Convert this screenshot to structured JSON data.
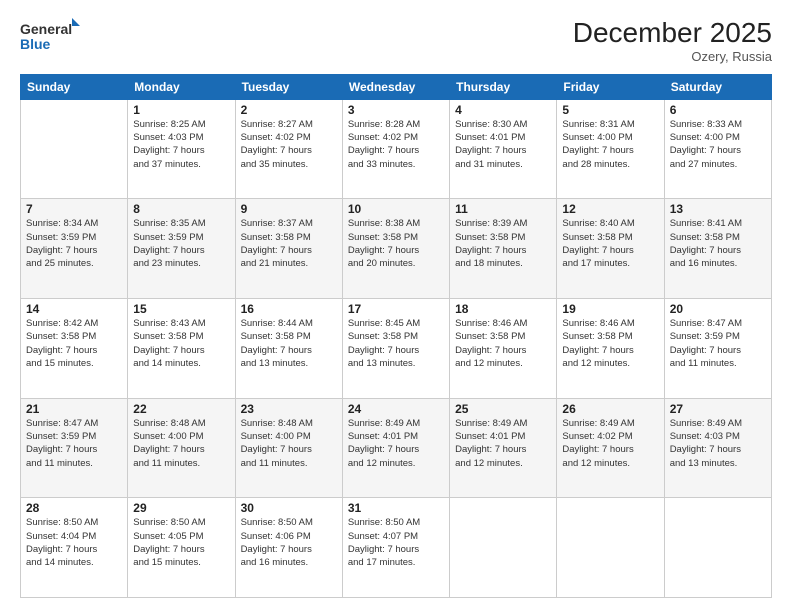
{
  "logo": {
    "line1": "General",
    "line2": "Blue"
  },
  "header": {
    "month": "December 2025",
    "location": "Ozery, Russia"
  },
  "weekdays": [
    "Sunday",
    "Monday",
    "Tuesday",
    "Wednesday",
    "Thursday",
    "Friday",
    "Saturday"
  ],
  "weeks": [
    [
      {
        "day": "",
        "info": ""
      },
      {
        "day": "1",
        "info": "Sunrise: 8:25 AM\nSunset: 4:03 PM\nDaylight: 7 hours\nand 37 minutes."
      },
      {
        "day": "2",
        "info": "Sunrise: 8:27 AM\nSunset: 4:02 PM\nDaylight: 7 hours\nand 35 minutes."
      },
      {
        "day": "3",
        "info": "Sunrise: 8:28 AM\nSunset: 4:02 PM\nDaylight: 7 hours\nand 33 minutes."
      },
      {
        "day": "4",
        "info": "Sunrise: 8:30 AM\nSunset: 4:01 PM\nDaylight: 7 hours\nand 31 minutes."
      },
      {
        "day": "5",
        "info": "Sunrise: 8:31 AM\nSunset: 4:00 PM\nDaylight: 7 hours\nand 28 minutes."
      },
      {
        "day": "6",
        "info": "Sunrise: 8:33 AM\nSunset: 4:00 PM\nDaylight: 7 hours\nand 27 minutes."
      }
    ],
    [
      {
        "day": "7",
        "info": "Sunrise: 8:34 AM\nSunset: 3:59 PM\nDaylight: 7 hours\nand 25 minutes."
      },
      {
        "day": "8",
        "info": "Sunrise: 8:35 AM\nSunset: 3:59 PM\nDaylight: 7 hours\nand 23 minutes."
      },
      {
        "day": "9",
        "info": "Sunrise: 8:37 AM\nSunset: 3:58 PM\nDaylight: 7 hours\nand 21 minutes."
      },
      {
        "day": "10",
        "info": "Sunrise: 8:38 AM\nSunset: 3:58 PM\nDaylight: 7 hours\nand 20 minutes."
      },
      {
        "day": "11",
        "info": "Sunrise: 8:39 AM\nSunset: 3:58 PM\nDaylight: 7 hours\nand 18 minutes."
      },
      {
        "day": "12",
        "info": "Sunrise: 8:40 AM\nSunset: 3:58 PM\nDaylight: 7 hours\nand 17 minutes."
      },
      {
        "day": "13",
        "info": "Sunrise: 8:41 AM\nSunset: 3:58 PM\nDaylight: 7 hours\nand 16 minutes."
      }
    ],
    [
      {
        "day": "14",
        "info": "Sunrise: 8:42 AM\nSunset: 3:58 PM\nDaylight: 7 hours\nand 15 minutes."
      },
      {
        "day": "15",
        "info": "Sunrise: 8:43 AM\nSunset: 3:58 PM\nDaylight: 7 hours\nand 14 minutes."
      },
      {
        "day": "16",
        "info": "Sunrise: 8:44 AM\nSunset: 3:58 PM\nDaylight: 7 hours\nand 13 minutes."
      },
      {
        "day": "17",
        "info": "Sunrise: 8:45 AM\nSunset: 3:58 PM\nDaylight: 7 hours\nand 13 minutes."
      },
      {
        "day": "18",
        "info": "Sunrise: 8:46 AM\nSunset: 3:58 PM\nDaylight: 7 hours\nand 12 minutes."
      },
      {
        "day": "19",
        "info": "Sunrise: 8:46 AM\nSunset: 3:58 PM\nDaylight: 7 hours\nand 12 minutes."
      },
      {
        "day": "20",
        "info": "Sunrise: 8:47 AM\nSunset: 3:59 PM\nDaylight: 7 hours\nand 11 minutes."
      }
    ],
    [
      {
        "day": "21",
        "info": "Sunrise: 8:47 AM\nSunset: 3:59 PM\nDaylight: 7 hours\nand 11 minutes."
      },
      {
        "day": "22",
        "info": "Sunrise: 8:48 AM\nSunset: 4:00 PM\nDaylight: 7 hours\nand 11 minutes."
      },
      {
        "day": "23",
        "info": "Sunrise: 8:48 AM\nSunset: 4:00 PM\nDaylight: 7 hours\nand 11 minutes."
      },
      {
        "day": "24",
        "info": "Sunrise: 8:49 AM\nSunset: 4:01 PM\nDaylight: 7 hours\nand 12 minutes."
      },
      {
        "day": "25",
        "info": "Sunrise: 8:49 AM\nSunset: 4:01 PM\nDaylight: 7 hours\nand 12 minutes."
      },
      {
        "day": "26",
        "info": "Sunrise: 8:49 AM\nSunset: 4:02 PM\nDaylight: 7 hours\nand 12 minutes."
      },
      {
        "day": "27",
        "info": "Sunrise: 8:49 AM\nSunset: 4:03 PM\nDaylight: 7 hours\nand 13 minutes."
      }
    ],
    [
      {
        "day": "28",
        "info": "Sunrise: 8:50 AM\nSunset: 4:04 PM\nDaylight: 7 hours\nand 14 minutes."
      },
      {
        "day": "29",
        "info": "Sunrise: 8:50 AM\nSunset: 4:05 PM\nDaylight: 7 hours\nand 15 minutes."
      },
      {
        "day": "30",
        "info": "Sunrise: 8:50 AM\nSunset: 4:06 PM\nDaylight: 7 hours\nand 16 minutes."
      },
      {
        "day": "31",
        "info": "Sunrise: 8:50 AM\nSunset: 4:07 PM\nDaylight: 7 hours\nand 17 minutes."
      },
      {
        "day": "",
        "info": ""
      },
      {
        "day": "",
        "info": ""
      },
      {
        "day": "",
        "info": ""
      }
    ]
  ]
}
